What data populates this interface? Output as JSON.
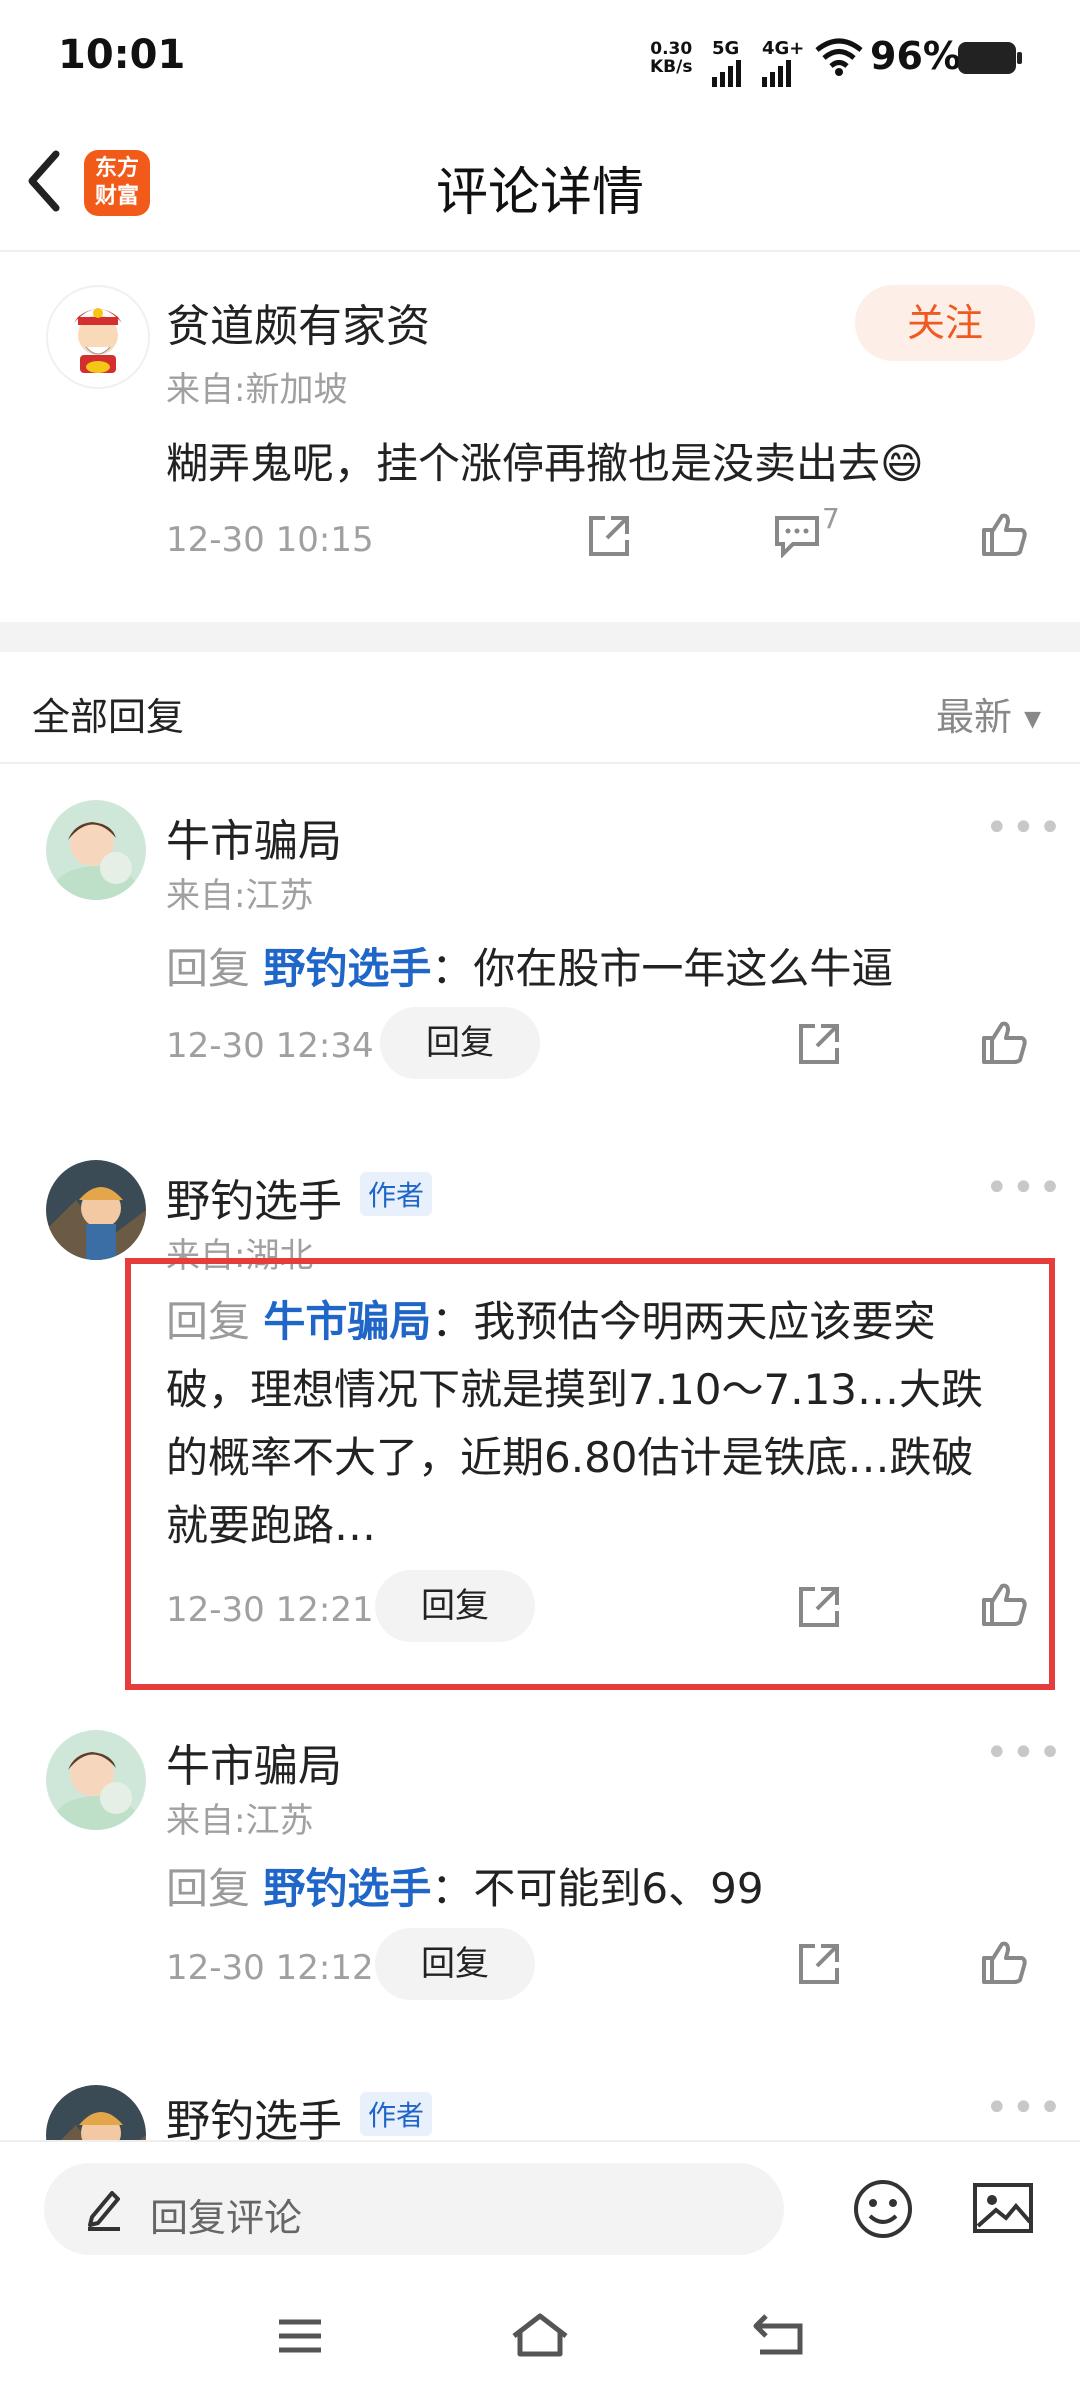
{
  "status_bar": {
    "time": "10:01",
    "net_speed_value": "0.30",
    "net_speed_unit": "KB/s",
    "sig1": "5G",
    "sig2": "4G+",
    "battery": "96%"
  },
  "header": {
    "title": "评论详情",
    "logo_line1": "东方",
    "logo_line2": "财富"
  },
  "main_comment": {
    "user": "贫道颇有家资",
    "location": "来自:新加坡",
    "content": "糊弄鬼呢，挂个涨停再撤也是没卖出去",
    "emoji": "😄",
    "time": "12-30 10:15",
    "follow_label": "关注",
    "comment_count": "7"
  },
  "replies_section": {
    "title": "全部回复",
    "sort": "最新"
  },
  "replies": [
    {
      "user": "牛市骗局",
      "location": "来自:江苏",
      "reply_prefix": "回复",
      "reply_to": "野钓选手",
      "sep": "：",
      "text": "你在股市一年这么牛逼",
      "time": "12-30 12:34",
      "reply_btn": "回复"
    },
    {
      "user": "野钓选手",
      "badge": "作者",
      "location": "来自:湖北",
      "reply_prefix": "回复",
      "reply_to": "牛市骗局",
      "sep": "：",
      "text_line1": "我预估今明两天应该要突",
      "text_line2": "破，理想情况下就是摸到7.10～7.13…大跌",
      "text_line3": "的概率不大了，近期6.80估计是铁底…跌破",
      "text_line4": "就要跑路…",
      "time": "12-30 12:21",
      "reply_btn": "回复"
    },
    {
      "user": "牛市骗局",
      "location": "来自:江苏",
      "reply_prefix": "回复",
      "reply_to": "野钓选手",
      "sep": "：",
      "text": "不可能到6、99",
      "time": "12-30 12:12",
      "reply_btn": "回复"
    },
    {
      "user": "野钓选手",
      "badge": "作者"
    }
  ],
  "bottom": {
    "reply_placeholder": "回复评论"
  },
  "colors": {
    "accent": "#ef5a21",
    "link_blue": "#1f66c8",
    "highlight_red": "#e53c3c"
  }
}
